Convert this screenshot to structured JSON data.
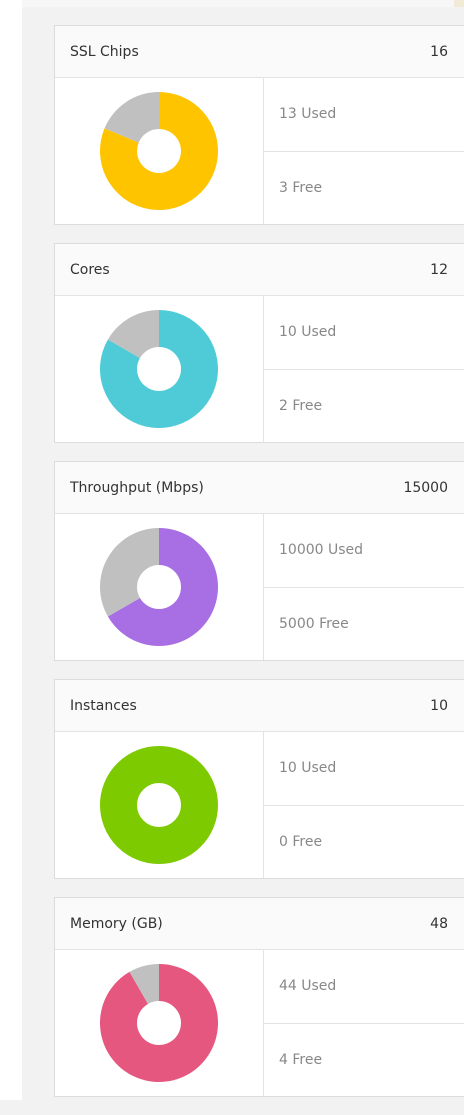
{
  "cards": [
    {
      "title": "SSL Chips",
      "total": "16",
      "used_label": "13 Used",
      "free_label": "3 Free",
      "used": 13,
      "free": 3,
      "color": "#ffc400",
      "free_color": "#c0c0c0"
    },
    {
      "title": "Cores",
      "total": "12",
      "used_label": "10 Used",
      "free_label": "2 Free",
      "used": 10,
      "free": 2,
      "color": "#4ecbd6",
      "free_color": "#c0c0c0"
    },
    {
      "title": "Throughput (Mbps)",
      "total": "15000",
      "used_label": "10000 Used",
      "free_label": "5000 Free",
      "used": 10000,
      "free": 5000,
      "color": "#a86ee3",
      "free_color": "#c0c0c0"
    },
    {
      "title": "Instances",
      "total": "10",
      "used_label": "10 Used",
      "free_label": "0 Free",
      "used": 10,
      "free": 0,
      "color": "#7dca00",
      "free_color": "#c0c0c0"
    },
    {
      "title": "Memory (GB)",
      "total": "48",
      "used_label": "44 Used",
      "free_label": "4 Free",
      "used": 44,
      "free": 4,
      "color": "#e5577f",
      "free_color": "#c0c0c0"
    }
  ]
}
